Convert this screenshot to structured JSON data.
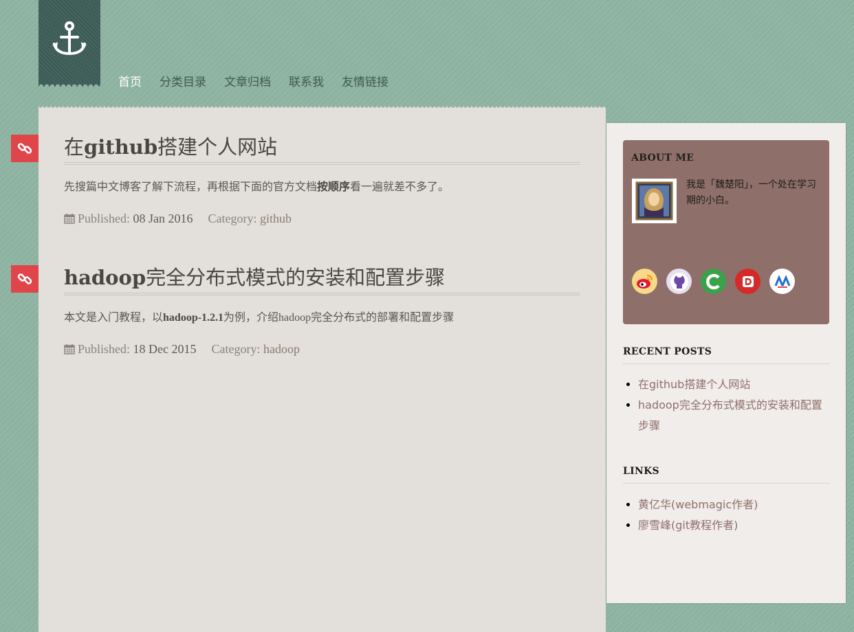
{
  "colors": {
    "background": "#8fb5a3",
    "logo_ribbon": "#3f5f59",
    "main_panel": "#e3dfda",
    "post_icon": "#e0454a",
    "about_panel": "#8f6f69",
    "link": "#8f6f69"
  },
  "logo": {
    "icon": "anchor-icon"
  },
  "nav": {
    "items": [
      {
        "label": "首页",
        "active": true
      },
      {
        "label": "分类目录"
      },
      {
        "label": "文章归档"
      },
      {
        "label": "联系我"
      },
      {
        "label": "友情链接"
      }
    ]
  },
  "posts": [
    {
      "icon": "link-icon",
      "title_prefix": "在",
      "title_bold": "github",
      "title_suffix": "搭建个人网站",
      "excerpt_prefix": "先搜篇中文博客了解下流程，再根据下面的官方文档",
      "excerpt_bold": "按顺序",
      "excerpt_suffix": "看一遍就差不多了。",
      "published_label": "Published:",
      "date": "08 Jan 2016",
      "category_label": "Category:",
      "category": "github"
    },
    {
      "icon": "link-icon",
      "title_prefix": "",
      "title_bold": "hadoop",
      "title_suffix": "完全分布式模式的安装和配置步骤",
      "excerpt_prefix": "本文是入门教程，以",
      "excerpt_bold": "hadoop-1.2.1",
      "excerpt_suffix": "为例，介绍hadoop完全分布式的部署和配置步骤",
      "published_label": "Published:",
      "date": "18 Dec 2015",
      "category_label": "Category:",
      "category": "hadoop"
    }
  ],
  "sidebar": {
    "about": {
      "title": "ABOUT ME",
      "text": "我是「魏楚阳」，一个处在学习期的小白。",
      "socials": [
        {
          "icon": "weibo-icon"
        },
        {
          "icon": "github-icon"
        },
        {
          "icon": "csdn-icon"
        },
        {
          "icon": "douban-icon"
        },
        {
          "icon": "zhihu-icon"
        }
      ]
    },
    "recent_posts": {
      "title": "RECENT POSTS",
      "items": [
        "在github搭建个人网站",
        "hadoop完全分布式模式的安装和配置步骤"
      ]
    },
    "links": {
      "title": "LINKS",
      "items": [
        "黄亿华(webmagic作者)",
        "廖雪峰(git教程作者)"
      ]
    }
  }
}
